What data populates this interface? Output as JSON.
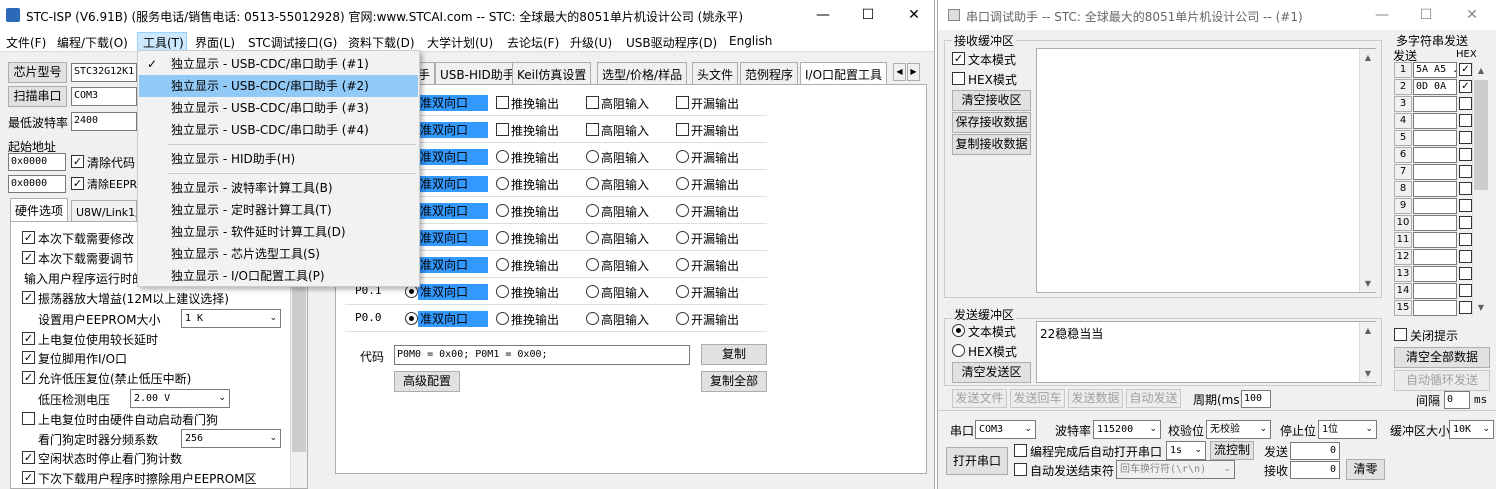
{
  "left_window": {
    "title": "STC-ISP (V6.91B) (服务电话/销售电话: 0513-55012928) 官网:www.STCAI.com  -- STC: 全球最大的8051单片机设计公司 (姚永平)",
    "menu": [
      "文件(F)",
      "编程/下载(O)",
      "工具(T)",
      "界面(L)",
      "STC调试接口(G)",
      "资料下载(D)",
      "大学计划(U)",
      "去论坛(F)",
      "升级(U)",
      "USB驱动程序(D)",
      "English"
    ],
    "chip_button": "芯片型号",
    "chip_value": "STC32G12K1",
    "scan_button": "扫描串口",
    "port_value": "COM3",
    "baud_label": "最低波特率",
    "baud_value": "2400",
    "start_addr_label": "起始地址",
    "addr1": "0x0000",
    "addr2": "0x0000",
    "clear_code": "清除代码",
    "clear_eeprom": "清除EEPR",
    "hw_tabs": [
      "硬件选项",
      "U8W/Link1脱"
    ],
    "hw_options": [
      {
        "text": "本次下载需要修改",
        "checked": true
      },
      {
        "text": "本次下载需要调节",
        "checked": true
      },
      {
        "text": "输入用户程序运行时的",
        "checked": null
      },
      {
        "text": "振荡器放大增益(12M以上建议选择)",
        "checked": true
      },
      {
        "text": "设置用户EEPROM大小",
        "checked": null,
        "select": "1   K"
      },
      {
        "text": "上电复位使用较长延时",
        "checked": true
      },
      {
        "text": "复位脚用作I/O口",
        "checked": true
      },
      {
        "text": "允许低压复位(禁止低压中断)",
        "checked": true
      },
      {
        "text": "低压检测电压",
        "checked": null,
        "select": "2.00 V"
      },
      {
        "text": "上电复位时由硬件自动启动看门狗",
        "checked": false
      },
      {
        "text": "看门狗定时器分频系数",
        "checked": null,
        "select": "256"
      },
      {
        "text": "空闲状态时停止看门狗计数",
        "checked": true
      },
      {
        "text": "下次下载用户程序时擦除用户EEPROM区",
        "checked": true
      }
    ],
    "tool_tabs": [
      "手",
      "USB-HID助手",
      "Keil仿真设置",
      "选型/价格/样品",
      "头文件",
      "范例程序",
      "I/O口配置工具"
    ],
    "io_rows": [
      {
        "pin": "",
        "mode": "准双向口"
      },
      {
        "pin": "",
        "mode": "准双向口"
      },
      {
        "pin": "",
        "mode": "准双向口"
      },
      {
        "pin": "",
        "mode": "准双向口"
      },
      {
        "pin": "",
        "mode": "准双向口"
      },
      {
        "pin": "",
        "mode": "准双向口"
      },
      {
        "pin": "",
        "mode": "准双向口"
      },
      {
        "pin": "P0.1",
        "mode": "准双向口"
      },
      {
        "pin": "P0.0",
        "mode": "准双向口"
      }
    ],
    "io_options": [
      "推挽输出",
      "高阻输入",
      "开漏输出"
    ],
    "code_label": "代码",
    "code_value": "P0M0 = 0x00;  P0M1 = 0x00;",
    "copy_button": "复制",
    "advanced_button": "高级配置",
    "copy_all_button": "复制全部"
  },
  "tools_menu": {
    "items": [
      {
        "label": "独立显示 - USB-CDC/串口助手 (#1)",
        "checked": true
      },
      {
        "label": "独立显示 - USB-CDC/串口助手 (#2)",
        "checked": false,
        "hot": true
      },
      {
        "label": "独立显示 - USB-CDC/串口助手 (#3)",
        "checked": false
      },
      {
        "label": "独立显示 - USB-CDC/串口助手 (#4)",
        "checked": false
      },
      {
        "label": "独立显示 - HID助手(H)",
        "checked": false
      },
      {
        "label": "独立显示 - 波特率计算工具(B)",
        "checked": false
      },
      {
        "label": "独立显示 - 定时器计算工具(T)",
        "checked": false
      },
      {
        "label": "独立显示 - 软件延时计算工具(D)",
        "checked": false
      },
      {
        "label": "独立显示 - 芯片选型工具(S)",
        "checked": false
      },
      {
        "label": "独立显示 - I/O口配置工具(P)",
        "checked": false
      }
    ]
  },
  "right_window": {
    "title": "串口调试助手 -- STC: 全球最大的8051单片机设计公司 -- (#1)",
    "recv_group": "接收缓冲区",
    "text_mode": "文本模式",
    "hex_mode": "HEX模式",
    "clear_recv": "清空接收区",
    "save_recv": "保存接收数据",
    "copy_recv": "复制接收数据",
    "send_group": "发送缓冲区",
    "send_text": "22稳稳当当",
    "clear_send": "清空发送区",
    "send_file": "发送文件",
    "send_cr": "发送回车",
    "send_data": "发送数据",
    "auto_send": "自动发送",
    "period_label": "周期(ms)",
    "period_value": "100",
    "multi_title": "多字符串发送",
    "multi_send_col": "发送",
    "multi_hex_col": "HEX",
    "multi_rows": [
      {
        "n": "1",
        "v": "5A A5 ...",
        "hex": true
      },
      {
        "n": "2",
        "v": "0D 0A",
        "hex": true
      },
      {
        "n": "3",
        "v": "",
        "hex": false
      },
      {
        "n": "4",
        "v": "",
        "hex": false
      },
      {
        "n": "5",
        "v": "",
        "hex": false
      },
      {
        "n": "6",
        "v": "",
        "hex": false
      },
      {
        "n": "7",
        "v": "",
        "hex": false
      },
      {
        "n": "8",
        "v": "",
        "hex": false
      },
      {
        "n": "9",
        "v": "",
        "hex": false
      },
      {
        "n": "10",
        "v": "",
        "hex": false
      },
      {
        "n": "11",
        "v": "",
        "hex": false
      },
      {
        "n": "12",
        "v": "",
        "hex": false
      },
      {
        "n": "13",
        "v": "",
        "hex": false
      },
      {
        "n": "14",
        "v": "",
        "hex": false
      },
      {
        "n": "15",
        "v": "",
        "hex": false
      }
    ],
    "close_hint": "关闭提示",
    "clear_all": "清空全部数据",
    "auto_loop": "自动循环发送",
    "interval_label": "间隔",
    "interval_value": "0",
    "interval_unit": "ms",
    "port_label": "串口",
    "port_value": "COM3",
    "baud_label": "波特率",
    "baud_value": "115200",
    "parity_label": "校验位",
    "parity_value": "无校验",
    "stop_label": "停止位",
    "stop_value": "1位",
    "buf_label": "缓冲区大小",
    "buf_value": "10K",
    "open_port": "打开串口",
    "auto_open": "编程完成后自动打开串口",
    "auto_open_time": "1s",
    "flow_ctrl": "流控制",
    "send_label": "发送",
    "send_count": "0",
    "auto_send_end": "自动发送结束符",
    "end_char": "回车换行符(\\r\\n)",
    "recv_label": "接收",
    "recv_count": "0",
    "clear_zero": "清零"
  }
}
